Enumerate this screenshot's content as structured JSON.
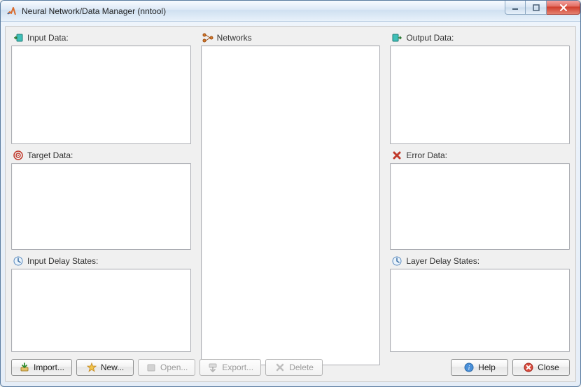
{
  "window": {
    "title": "Neural Network/Data Manager (nntool)"
  },
  "panels": {
    "input_data": {
      "label": "Input Data:"
    },
    "networks": {
      "label": "Networks"
    },
    "output_data": {
      "label": "Output Data:"
    },
    "target_data": {
      "label": "Target Data:"
    },
    "error_data": {
      "label": "Error Data:"
    },
    "input_delay_states": {
      "label": "Input Delay States:"
    },
    "layer_delay_states": {
      "label": "Layer Delay States:"
    }
  },
  "toolbar": {
    "import": "Import...",
    "new": "New...",
    "open": "Open...",
    "export": "Export...",
    "delete": "Delete",
    "help": "Help",
    "close": "Close"
  }
}
